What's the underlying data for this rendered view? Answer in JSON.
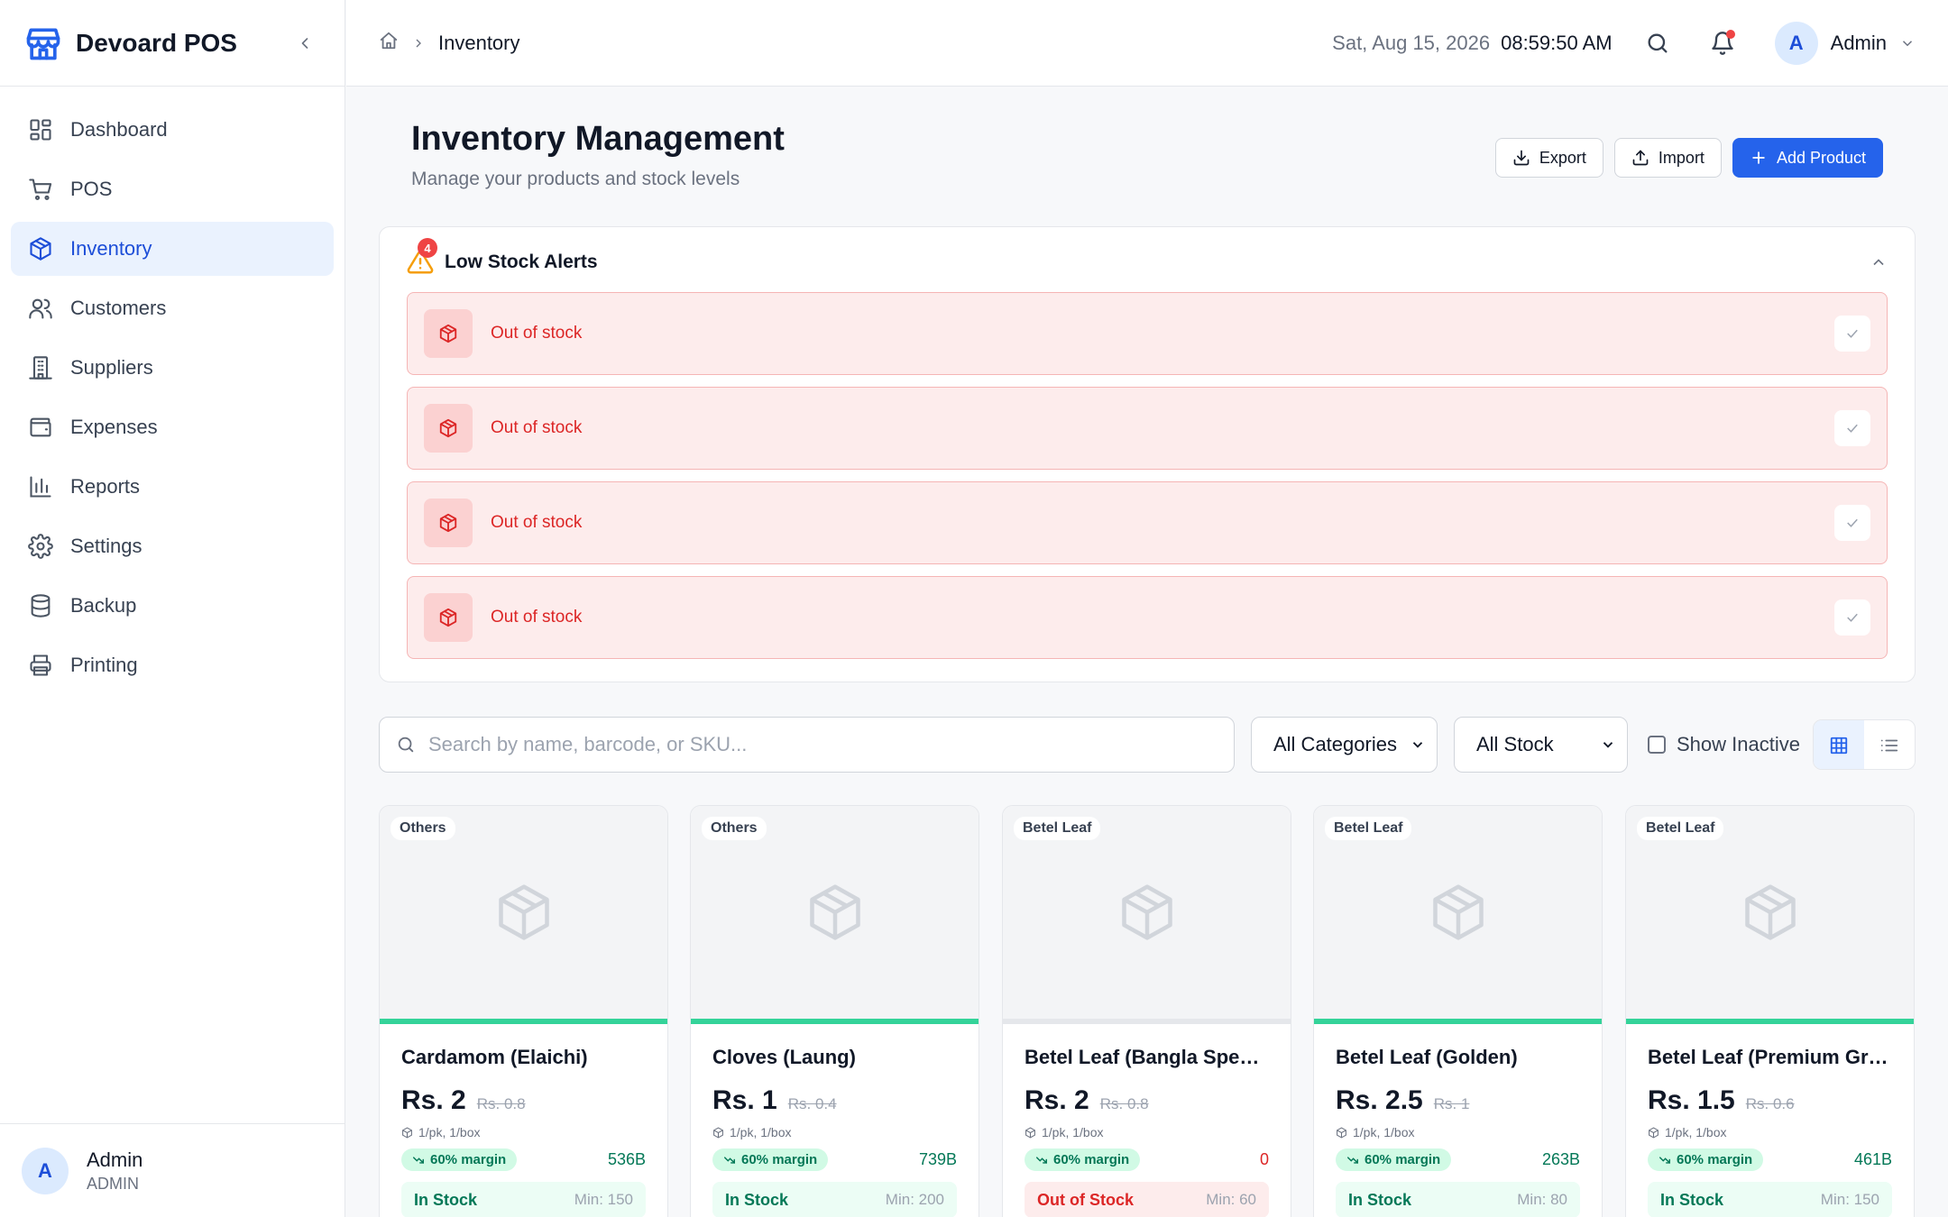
{
  "app": {
    "name": "Devoard POS"
  },
  "sidebar": {
    "items": [
      {
        "label": "Dashboard",
        "icon": "dashboard-icon"
      },
      {
        "label": "POS",
        "icon": "cart-icon"
      },
      {
        "label": "Inventory",
        "icon": "box-icon",
        "active": true
      },
      {
        "label": "Customers",
        "icon": "users-icon"
      },
      {
        "label": "Suppliers",
        "icon": "building-icon"
      },
      {
        "label": "Expenses",
        "icon": "wallet-icon"
      },
      {
        "label": "Reports",
        "icon": "chart-icon"
      },
      {
        "label": "Settings",
        "icon": "gear-icon"
      },
      {
        "label": "Backup",
        "icon": "database-icon"
      },
      {
        "label": "Printing",
        "icon": "printer-icon"
      }
    ],
    "user": {
      "initial": "A",
      "name": "Admin",
      "role": "ADMIN"
    }
  },
  "header": {
    "breadcrumb": "Inventory",
    "date": "Sat, Aug 15, 2026",
    "time": "08:59:50 AM",
    "user": {
      "initial": "A",
      "name": "Admin"
    }
  },
  "page": {
    "title": "Inventory Management",
    "subtitle": "Manage your products and stock levels",
    "actions": {
      "export": "Export",
      "import": "Import",
      "add": "Add Product"
    }
  },
  "alerts": {
    "title": "Low Stock Alerts",
    "count": "4",
    "rows": [
      {
        "text": "Out of stock"
      },
      {
        "text": "Out of stock"
      },
      {
        "text": "Out of stock"
      },
      {
        "text": "Out of stock"
      }
    ]
  },
  "filters": {
    "search_placeholder": "Search by name, barcode, or SKU...",
    "category": "All Categories",
    "stock": "All Stock",
    "show_inactive": "Show Inactive"
  },
  "products": [
    {
      "category": "Others",
      "name": "Cardamom (Elaichi)",
      "price": "Rs. 2",
      "old_price": "Rs. 0.8",
      "unit": "1/pk, 1/box",
      "margin": "60% margin",
      "stock": "536B",
      "status": "In Stock",
      "min": "Min: 150",
      "in_stock": true
    },
    {
      "category": "Others",
      "name": "Cloves (Laung)",
      "price": "Rs. 1",
      "old_price": "Rs. 0.4",
      "unit": "1/pk, 1/box",
      "margin": "60% margin",
      "stock": "739B",
      "status": "In Stock",
      "min": "Min: 200",
      "in_stock": true
    },
    {
      "category": "Betel Leaf",
      "name": "Betel Leaf (Bangla Speci...",
      "price": "Rs. 2",
      "old_price": "Rs. 0.8",
      "unit": "1/pk, 1/box",
      "margin": "60% margin",
      "stock": "0",
      "status": "Out of Stock",
      "min": "Min: 60",
      "in_stock": false
    },
    {
      "category": "Betel Leaf",
      "name": "Betel Leaf (Golden)",
      "price": "Rs. 2.5",
      "old_price": "Rs. 1",
      "unit": "1/pk, 1/box",
      "margin": "60% margin",
      "stock": "263B",
      "status": "In Stock",
      "min": "Min: 80",
      "in_stock": true
    },
    {
      "category": "Betel Leaf",
      "name": "Betel Leaf (Premium Gre...",
      "price": "Rs. 1.5",
      "old_price": "Rs. 0.6",
      "unit": "1/pk, 1/box",
      "margin": "60% margin",
      "stock": "461B",
      "status": "In Stock",
      "min": "Min: 150",
      "in_stock": true
    }
  ],
  "colors": {
    "accent": "#2563eb",
    "danger": "#dc2626",
    "success": "#047857"
  }
}
